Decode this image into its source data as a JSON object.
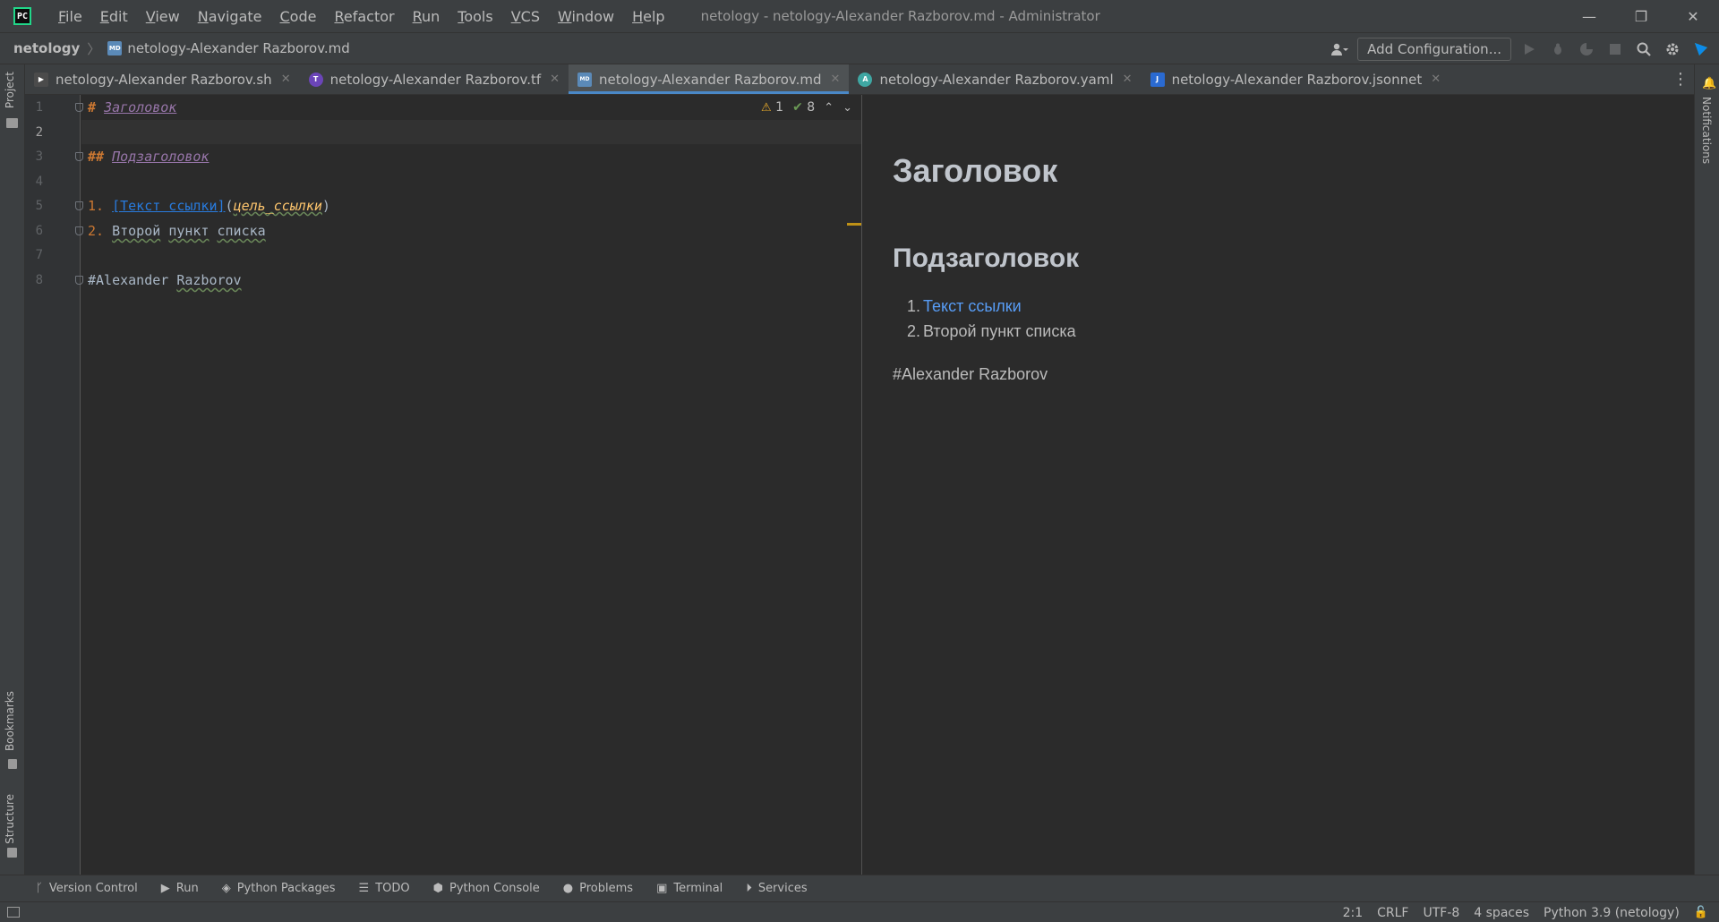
{
  "titlebar": {
    "logo": "PC",
    "menu": [
      "File",
      "Edit",
      "View",
      "Navigate",
      "Code",
      "Refactor",
      "Run",
      "Tools",
      "VCS",
      "Window",
      "Help"
    ],
    "title": "netology - netology-Alexander Razborov.md - Administrator",
    "controls": {
      "minimize": "—",
      "restore": "❐",
      "close": "✕"
    }
  },
  "navbar": {
    "project": "netology",
    "separator": "〉",
    "file": "netology-Alexander Razborov.md",
    "md_badge": "MD",
    "add_configuration": "Add Configuration..."
  },
  "tabs": [
    {
      "label": "netology-Alexander Razborov.sh",
      "icon": "shell-icon",
      "badge": "▶",
      "color": "#4b4b4b",
      "active": false
    },
    {
      "label": "netology-Alexander Razborov.tf",
      "icon": "terraform-icon",
      "badge": "T",
      "color": "#6b45b8",
      "active": false
    },
    {
      "label": "netology-Alexander Razborov.md",
      "icon": "markdown-icon",
      "badge": "MD",
      "color": "#5b8ab8",
      "active": true
    },
    {
      "label": "netology-Alexander Razborov.yaml",
      "icon": "yaml-icon",
      "badge": "A",
      "color": "#3fa7a3",
      "active": false
    },
    {
      "label": "netology-Alexander Razborov.jsonnet",
      "icon": "jsonnet-icon",
      "badge": "J",
      "color": "#2a6ad1",
      "active": false
    }
  ],
  "tab_close": "✕",
  "tab_more": "⋮",
  "left_strip": {
    "project": "Project",
    "bookmarks": "Bookmarks",
    "structure": "Structure"
  },
  "right_strip": {
    "notifications": "Notifications",
    "bell": "🔔"
  },
  "editor": {
    "line_numbers": [
      "1",
      "2",
      "3",
      "4",
      "5",
      "6",
      "7",
      "8"
    ],
    "current_line": 2,
    "line1": {
      "marker": "# ",
      "text": "Заголовок"
    },
    "line3": {
      "marker": "## ",
      "text": "Подзаголовок"
    },
    "line5": {
      "marker": "1. ",
      "link_text": "[Текст ссылки]",
      "open": "(",
      "link_dest": "цель_ссылки",
      "close": ")"
    },
    "line6": {
      "marker": "2. ",
      "w1": "Второй",
      "w2": "пункт",
      "w3": "списка"
    },
    "line8": {
      "prefix": "#Alexander ",
      "word": "Razborov"
    },
    "inspections": {
      "warnings": "1",
      "weak_warnings": "8",
      "warn_glyph": "⚠",
      "check_glyph": "✔",
      "up": "⌃",
      "down": "⌄"
    }
  },
  "preview": {
    "h1": "Заголовок",
    "h2": "Подзаголовок",
    "list": [
      {
        "num": "1.",
        "text": "Текст ссылки",
        "link": true
      },
      {
        "num": "2.",
        "text": "Второй пункт списка",
        "link": false
      }
    ],
    "paragraph": "#Alexander Razborov"
  },
  "toolwindows": [
    {
      "label": "Version Control",
      "icon": "branch-icon",
      "glyph": "ᚴ"
    },
    {
      "label": "Run",
      "icon": "run-icon",
      "glyph": "▶"
    },
    {
      "label": "Python Packages",
      "icon": "layers-icon",
      "glyph": "◈"
    },
    {
      "label": "TODO",
      "icon": "list-icon",
      "glyph": "☰"
    },
    {
      "label": "Python Console",
      "icon": "python-icon",
      "glyph": "⬢"
    },
    {
      "label": "Problems",
      "icon": "problems-icon",
      "glyph": "●"
    },
    {
      "label": "Terminal",
      "icon": "terminal-icon",
      "glyph": "▣"
    },
    {
      "label": "Services",
      "icon": "services-icon",
      "glyph": "⏵"
    }
  ],
  "statusbar": {
    "position": "2:1",
    "line_separator": "CRLF",
    "encoding": "UTF-8",
    "indent": "4 spaces",
    "interpreter": "Python 3.9 (netology)",
    "lock": "🔓"
  }
}
